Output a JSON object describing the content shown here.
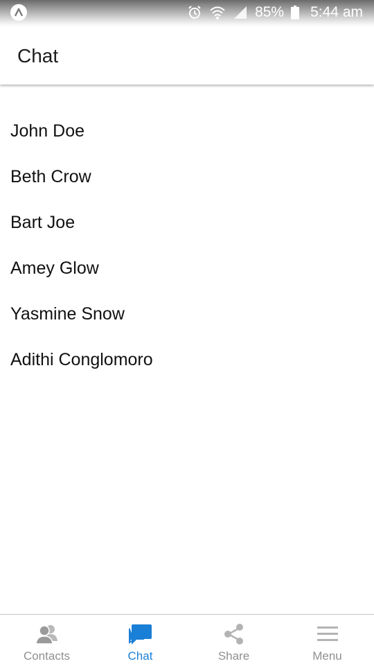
{
  "status_bar": {
    "battery": "85%",
    "time": "5:44 am"
  },
  "app_bar": {
    "title": "Chat"
  },
  "chats": [
    {
      "name": "John Doe"
    },
    {
      "name": "Beth Crow"
    },
    {
      "name": "Bart Joe"
    },
    {
      "name": "Amey Glow"
    },
    {
      "name": "Yasmine Snow"
    },
    {
      "name": "Adithi Conglomoro"
    }
  ],
  "bottom_nav": {
    "tabs": [
      {
        "label": "Contacts",
        "icon": "contacts-icon",
        "active": false
      },
      {
        "label": "Chat",
        "icon": "chat-icon",
        "active": true
      },
      {
        "label": "Share",
        "icon": "share-icon",
        "active": false
      },
      {
        "label": "Menu",
        "icon": "menu-icon",
        "active": false
      }
    ]
  },
  "colors": {
    "accent": "#1a7fd6",
    "inactive": "#8f8f8f"
  }
}
